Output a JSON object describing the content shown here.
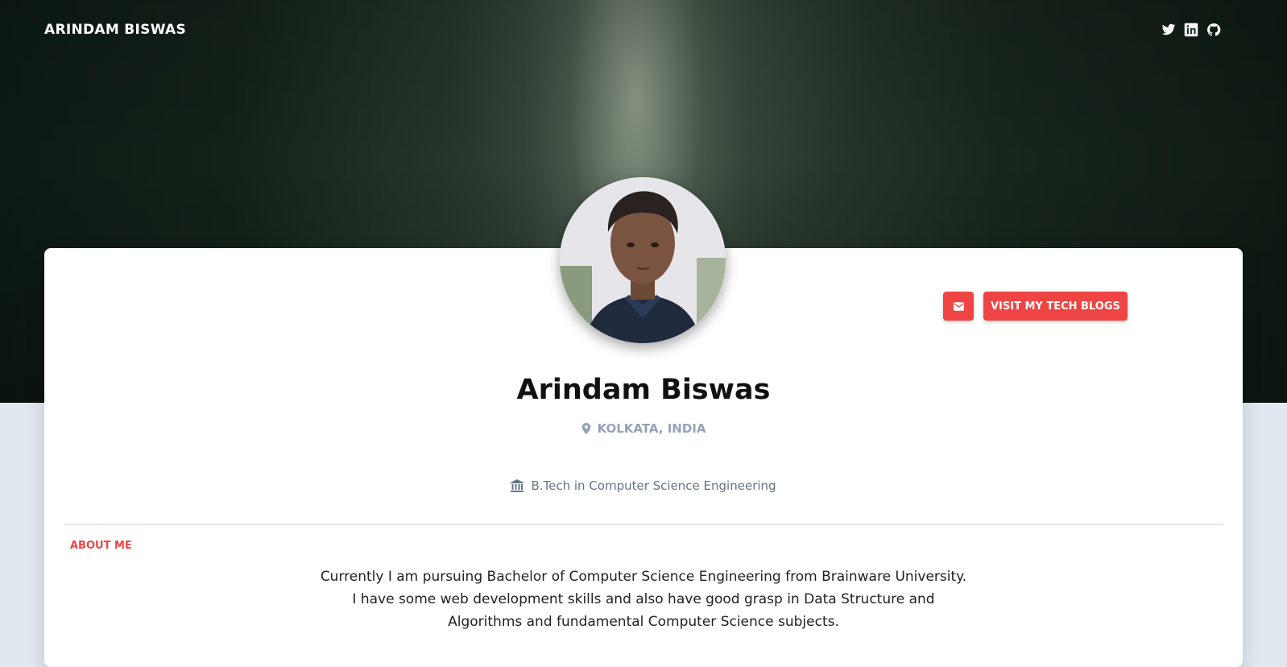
{
  "header": {
    "brand": "ARINDAM BISWAS",
    "social_icons": [
      "twitter-icon",
      "linkedin-icon",
      "github-icon"
    ]
  },
  "profile": {
    "name": "Arindam Biswas",
    "location": "KOLKATA, INDIA",
    "education": "B.Tech in Computer Science Engineering",
    "avatar_description_icon": "avatar"
  },
  "actions": {
    "mail_icon": "mail-icon",
    "blogs_label": "VISIT MY TECH BLOGS"
  },
  "about": {
    "heading": "ABOUT ME",
    "lines": [
      "Currently I am pursuing Bachelor of Computer Science Engineering from Brainware University.",
      "I have some web development skills and also have good grasp in Data Structure and",
      "Algorithms and fundamental Computer Science subjects."
    ]
  },
  "colors": {
    "accent": "#ef4444",
    "page_background": "#e2e8f0",
    "muted": "#94a3b8"
  }
}
